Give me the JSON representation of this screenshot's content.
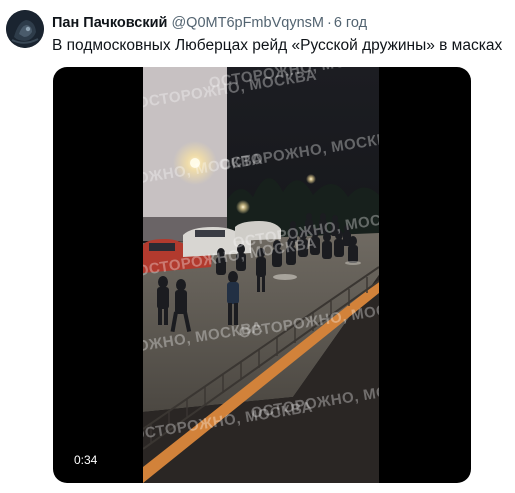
{
  "tweet": {
    "author": {
      "display_name": "Пан Пачковский",
      "handle": "@Q0MT6pFmbVqynsM",
      "avatar_icon": "profile-avatar"
    },
    "separator": "·",
    "timestamp": "6 год",
    "text": "В подмосковных Люберцах рейд «Русской дружины» в масках",
    "media": {
      "type": "video",
      "duration": "0:34",
      "watermark": "ОСТОРОЖНО, МОСКВА"
    }
  },
  "colors": {
    "name_text": "#0f1419",
    "secondary_text": "#536471",
    "media_background": "#000000"
  }
}
